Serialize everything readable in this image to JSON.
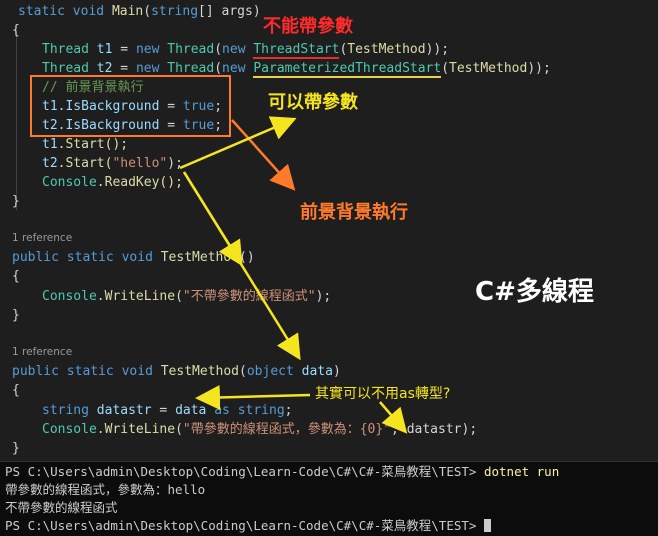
{
  "code": {
    "main_static": "static",
    "main_void": "void",
    "main_name": "Main",
    "main_params_open": "(",
    "main_string": "string",
    "main_params_rest": "[] args)",
    "brace_open": "{",
    "brace_close": "}",
    "thread_type": "Thread",
    "t1": "t1",
    "t2": "t2",
    "eq": " = ",
    "new_kw": "new",
    "thread_ctor": "Thread",
    "paren_open": "(",
    "threadstart": "ThreadStart",
    "ptstart": "ParameterizedThreadStart",
    "testmethod": "TestMethod",
    "close1": "));",
    "comment": "// 前景背景執行",
    "isbg": ".IsBackground",
    "true_kw": "true",
    "semi": ";",
    "start1": ".Start();",
    "start2_a": ".Start(",
    "hello_str": "\"hello\"",
    "start2_b": ");",
    "console": "Console",
    "readkey": ".ReadKey();",
    "ref1": "1 reference",
    "ref2": "1 reference",
    "public_kw": "public",
    "static_kw": "static",
    "void_kw": "void",
    "tm_name": "TestMethod",
    "tm1_params": "()",
    "writeline": "WriteLine",
    "str1": "\"不帶參數的線程函式\"",
    "tail1": ");",
    "tm2_open": "(",
    "object_kw": "object",
    "data_var": "data",
    "tm2_close": ")",
    "string_kw": "string",
    "datastr": "datastr",
    "as_kw": "as",
    "str2": "\"帶參數的線程函式，參數為：{0}\"",
    "tail2": ", datastr);"
  },
  "annotations": {
    "no_param": "不能帶參數",
    "can_param": "可以帶參數",
    "fg_bg": "前景背景執行",
    "title": "C#多線程",
    "question": "其實可以不用as轉型?"
  },
  "terminal": {
    "prompt1": "PS C:\\Users\\admin\\Desktop\\Coding\\Learn-Code\\C#\\C#-菜鳥教程\\TEST>",
    "cmd": "dotnet run",
    "out1": "帶參數的線程函式，參數為：hello",
    "out2": "不帶參數的線程函式",
    "prompt2": "PS C:\\Users\\admin\\Desktop\\Coding\\Learn-Code\\C#\\C#-菜鳥教程\\TEST>"
  },
  "colors": {
    "keyword": "#569cd6",
    "type": "#4ec9b0",
    "function": "#dcdcaa",
    "variable": "#9cdcfe",
    "string": "#ce9178",
    "comment": "#6a9955",
    "annotation_red": "#ff2a2a",
    "annotation_yellow": "#f5e51f",
    "annotation_orange": "#ff7a2a"
  }
}
